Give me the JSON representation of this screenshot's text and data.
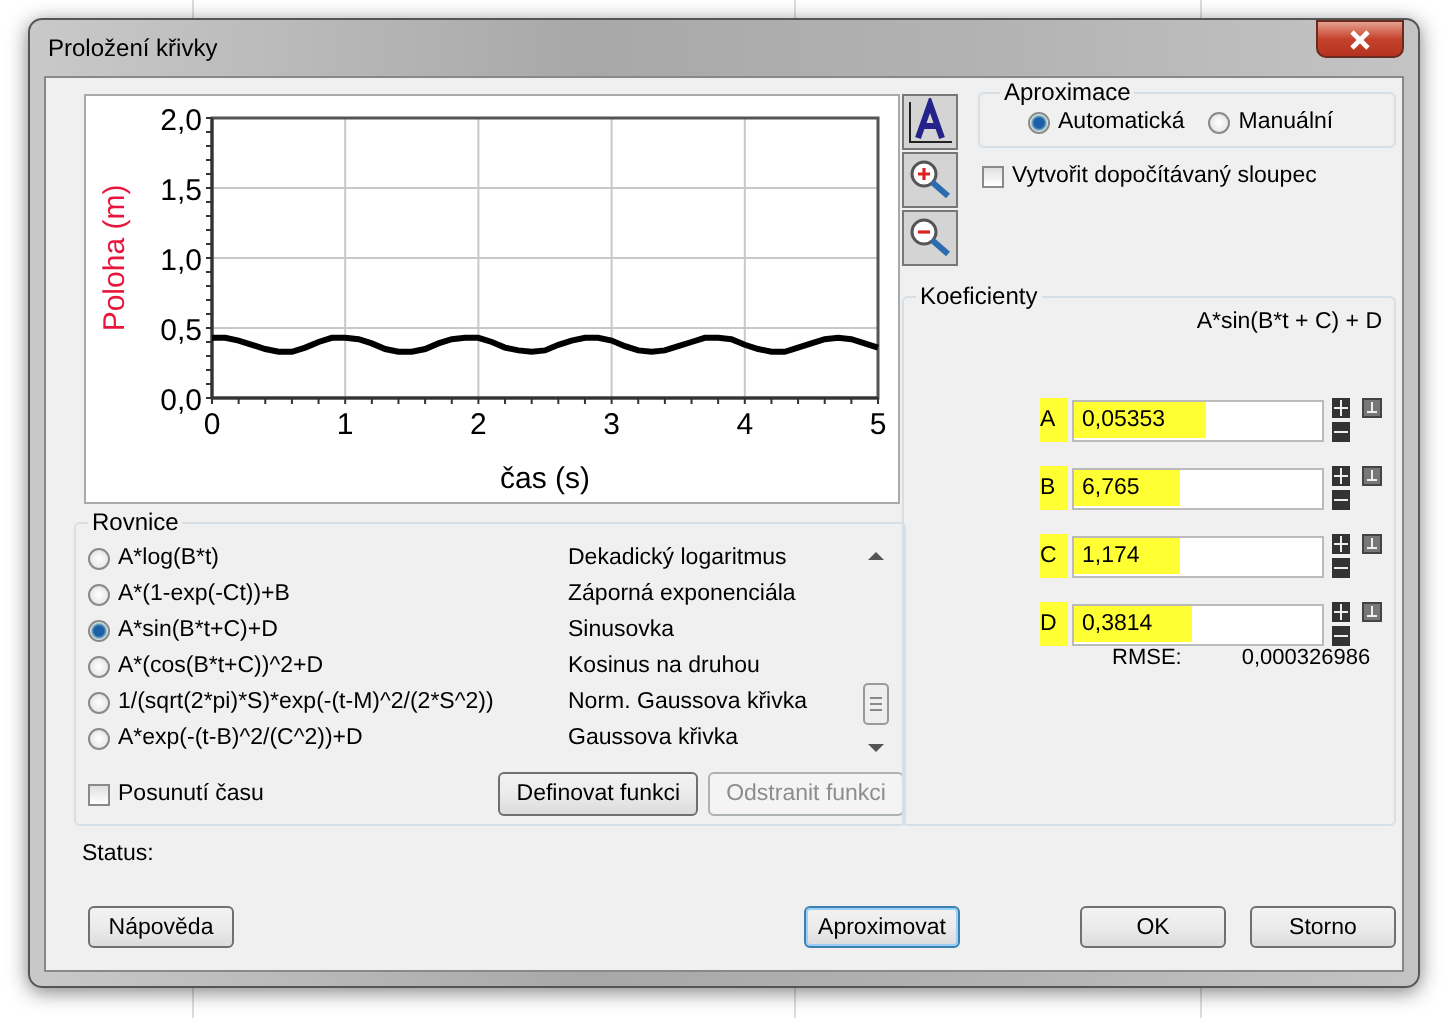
{
  "window": {
    "title": "Proložení křivky"
  },
  "chart": {
    "chart_data": {
      "type": "line",
      "grid": true,
      "xlabel": "čas (s)",
      "ylabel": "Poloha (m)",
      "xlim": [
        0,
        5
      ],
      "ylim": [
        0,
        2
      ],
      "xticks": [
        0,
        1,
        2,
        3,
        4,
        5
      ],
      "yticks": [
        {
          "value": 0,
          "label": "0,0"
        },
        {
          "value": 0.5,
          "label": "0,5"
        },
        {
          "value": 1,
          "label": "1,0"
        },
        {
          "value": 1.5,
          "label": "1,5"
        },
        {
          "value": 2,
          "label": "2,0"
        }
      ],
      "x": [
        0,
        0.1,
        0.2,
        0.3,
        0.4,
        0.5,
        0.6,
        0.7,
        0.8,
        0.9,
        1,
        1.1,
        1.2,
        1.3,
        1.4,
        1.5,
        1.6,
        1.7,
        1.8,
        1.9,
        2,
        2.1,
        2.2,
        2.3,
        2.4,
        2.5,
        2.6,
        2.7,
        2.8,
        2.9,
        3,
        3.1,
        3.2,
        3.3,
        3.4,
        3.5,
        3.6,
        3.7,
        3.8,
        3.9,
        4,
        4.1,
        4.2,
        4.3,
        4.4,
        4.5,
        4.6,
        4.7,
        4.8,
        4.9,
        5
      ],
      "series": [
        {
          "color": "#000000",
          "values": [
            0.43,
            0.43,
            0.41,
            0.38,
            0.35,
            0.33,
            0.33,
            0.36,
            0.4,
            0.43,
            0.43,
            0.42,
            0.39,
            0.35,
            0.33,
            0.33,
            0.35,
            0.39,
            0.42,
            0.43,
            0.43,
            0.4,
            0.36,
            0.34,
            0.33,
            0.34,
            0.38,
            0.41,
            0.43,
            0.43,
            0.41,
            0.37,
            0.34,
            0.33,
            0.34,
            0.37,
            0.4,
            0.43,
            0.43,
            0.42,
            0.38,
            0.35,
            0.33,
            0.33,
            0.36,
            0.39,
            0.42,
            0.43,
            0.42,
            0.39,
            0.36
          ]
        }
      ]
    }
  },
  "approximation": {
    "title": "Aproximace",
    "options": [
      {
        "label": "Automatická",
        "selected": true
      },
      {
        "label": "Manuální",
        "selected": false
      }
    ]
  },
  "computed_column": {
    "label": "Vytvořit dopočítávaný sloupec",
    "checked": false
  },
  "equations": {
    "title": "Rovnice",
    "items": [
      {
        "formula": "A*log(B*t)",
        "name": "Dekadický logaritmus",
        "selected": false
      },
      {
        "formula": "A*(1-exp(-Ct))+B",
        "name": "Záporná exponenciála",
        "selected": false
      },
      {
        "formula": "A*sin(B*t+C)+D",
        "name": "Sinusovka",
        "selected": true
      },
      {
        "formula": "A*(cos(B*t+C))^2+D",
        "name": "Kosinus na druhou",
        "selected": false
      },
      {
        "formula": "1/(sqrt(2*pi)*S)*exp(-(t-M)^2/(2*S^2))",
        "name": "Norm. Gaussova křivka",
        "selected": false
      },
      {
        "formula": "A*exp(-(t-B)^2/(C^2))+D",
        "name": "Gaussova křivka",
        "selected": false
      }
    ],
    "time_shift": {
      "label": "Posunutí času",
      "checked": false
    },
    "buttons": [
      {
        "label": "Definovat funkci",
        "disabled": false
      },
      {
        "label": "Odstranit funkci",
        "disabled": true
      }
    ]
  },
  "coefficients": {
    "title": "Koeficienty",
    "formula": "A*sin(B*t + C) + D",
    "rows": [
      {
        "name": "A",
        "value": "0,05353",
        "highlighted": true
      },
      {
        "name": "B",
        "value": "6,765",
        "highlighted": true
      },
      {
        "name": "C",
        "value": "1,174",
        "highlighted": true
      },
      {
        "name": "D",
        "value": "0,3814",
        "highlighted": true
      }
    ],
    "rmse_label": "RMSE:",
    "rmse_value": "0,000326986"
  },
  "status": {
    "label": "Status:"
  },
  "buttons": [
    {
      "label": "Nápověda",
      "focused": false
    },
    {
      "label": "Aproximovat",
      "focused": true
    },
    {
      "label": "OK",
      "focused": false
    },
    {
      "label": "Storno",
      "focused": false
    }
  ]
}
